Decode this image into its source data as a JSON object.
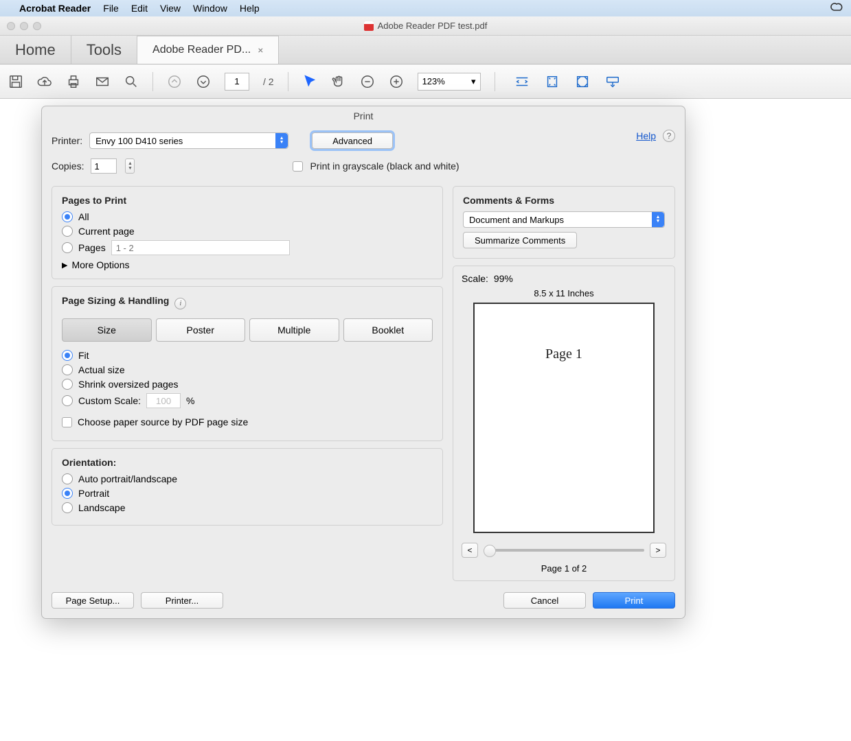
{
  "menubar": {
    "app": "Acrobat Reader",
    "items": [
      "File",
      "Edit",
      "View",
      "Window",
      "Help"
    ]
  },
  "window": {
    "title": "Adobe Reader PDF test.pdf"
  },
  "apptabs": {
    "home": "Home",
    "tools": "Tools",
    "doc": "Adobe Reader PD...",
    "close": "×"
  },
  "toolbar": {
    "page_current": "1",
    "page_sep": "/",
    "page_total": "2",
    "zoom": "123%",
    "zoom_chevron": "▾"
  },
  "dialog": {
    "title": "Print",
    "printer_label": "Printer:",
    "printer_value": "Envy 100 D410 series",
    "advanced": "Advanced",
    "help": "Help",
    "copies_label": "Copies:",
    "copies_value": "1",
    "grayscale": "Print in grayscale (black and white)",
    "pages_to_print": {
      "heading": "Pages to Print",
      "all": "All",
      "current": "Current page",
      "pages": "Pages",
      "pages_placeholder": "1 - 2",
      "more": "More Options"
    },
    "sizing": {
      "heading": "Page Sizing & Handling",
      "seg": {
        "size": "Size",
        "poster": "Poster",
        "multiple": "Multiple",
        "booklet": "Booklet"
      },
      "fit": "Fit",
      "actual": "Actual size",
      "shrink": "Shrink oversized pages",
      "custom": "Custom Scale:",
      "custom_val": "100",
      "percent": "%",
      "choose_source": "Choose paper source by PDF page size"
    },
    "orientation": {
      "heading": "Orientation:",
      "auto": "Auto portrait/landscape",
      "portrait": "Portrait",
      "landscape": "Landscape"
    },
    "comments": {
      "heading": "Comments & Forms",
      "value": "Document and Markups",
      "summarize": "Summarize Comments"
    },
    "preview": {
      "scale_label": "Scale:",
      "scale_value": "99%",
      "dims": "8.5 x 11 Inches",
      "page_content": "Page 1",
      "prev": "<",
      "next": ">",
      "counter": "Page 1 of 2"
    },
    "footer": {
      "page_setup": "Page Setup...",
      "printer_btn": "Printer...",
      "cancel": "Cancel",
      "print": "Print"
    }
  }
}
